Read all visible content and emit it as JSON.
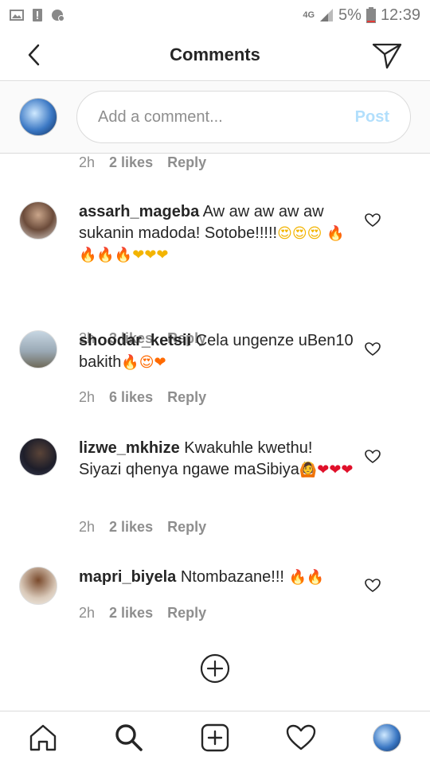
{
  "status_bar": {
    "network": "4G",
    "battery": "5%",
    "time": "12:39"
  },
  "header": {
    "title": "Comments"
  },
  "composer": {
    "placeholder": "Add a comment...",
    "post_label": "Post"
  },
  "top_meta": {
    "time": "2h",
    "likes": "2 likes",
    "reply": "Reply"
  },
  "comments": [
    {
      "username": "assarh_mageba",
      "text": "Aw aw aw aw aw sukanin madoda! Sotobe!!!!!",
      "emojis": "😍😍😍 🔥🔥🔥🔥❤❤❤",
      "time": "2h",
      "likes": "3 likes",
      "reply": "Reply"
    },
    {
      "username": "shoodar_ketsii",
      "text": "Cela ungenze uBen10 bakith",
      "emojis": "🔥😍❤",
      "time": "2h",
      "likes": "6 likes",
      "reply": "Reply"
    },
    {
      "username": "lizwe_mkhize",
      "text": "Kwakuhle kwethu! Siyazi qhenya ngawe maSibiya",
      "emojis": "🙆❤❤❤",
      "time": "2h",
      "likes": "2 likes",
      "reply": "Reply"
    },
    {
      "username": "mapri_biyela",
      "text": "Ntombazane!!!",
      "emojis": "🔥🔥",
      "time": "2h",
      "likes": "2 likes",
      "reply": "Reply"
    }
  ],
  "icons": {
    "back": "chevron-left-icon",
    "send": "paper-plane-icon",
    "heart": "heart-outline-icon",
    "load_more": "plus-circle-icon",
    "home": "home-icon",
    "search": "search-icon",
    "new_post": "plus-square-icon",
    "activity": "heart-icon",
    "profile": "profile-avatar"
  }
}
